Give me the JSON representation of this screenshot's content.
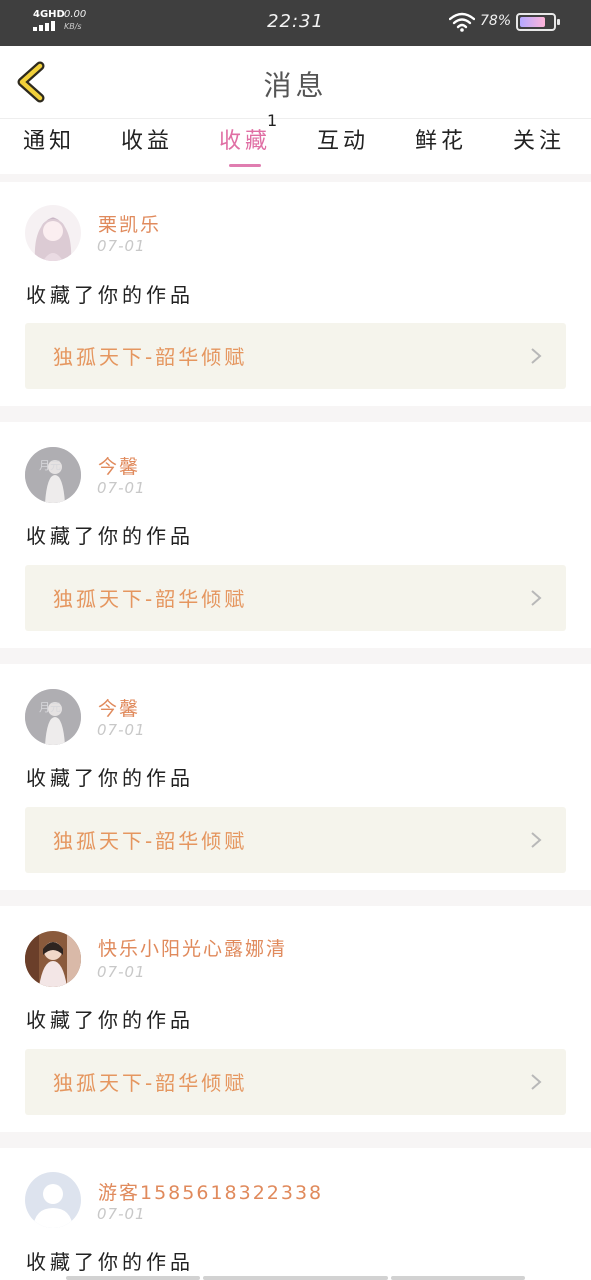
{
  "status_bar": {
    "network": "4GHD",
    "speed": "0.00",
    "speed_unit": "KB/s",
    "time": "22:31",
    "battery": "78%"
  },
  "header": {
    "title": "消息"
  },
  "tabs": [
    {
      "label": "通知"
    },
    {
      "label": "收益"
    },
    {
      "label": "收藏",
      "badge": "1",
      "active": true
    },
    {
      "label": "互动"
    },
    {
      "label": "鲜花"
    },
    {
      "label": "关注"
    }
  ],
  "items": [
    {
      "user": "栗凯乐",
      "date": "07-01",
      "action": "收藏了你的作品",
      "work": "独孤天下-韶华倾赋",
      "avatar": "anime-girl"
    },
    {
      "user": "今馨",
      "date": "07-01",
      "action": "收藏了你的作品",
      "work": "独孤天下-韶华倾赋",
      "avatar": "grey-photo"
    },
    {
      "user": "今馨",
      "date": "07-01",
      "action": "收藏了你的作品",
      "work": "独孤天下-韶华倾赋",
      "avatar": "grey-photo"
    },
    {
      "user": "快乐小阳光心露娜清",
      "date": "07-01",
      "action": "收藏了你的作品",
      "work": "独孤天下-韶华倾赋",
      "avatar": "photo-girl"
    },
    {
      "user": "游客1585618322338",
      "date": "07-01",
      "action": "收藏了你的作品",
      "work": "独孤天下-韶华倾赋",
      "avatar": "default-person"
    }
  ],
  "colors": {
    "accent_pink": "#e06fa4",
    "name_orange": "#e08a5c",
    "link_bg": "#f5f4ec",
    "badge_red": "#f24b5f"
  }
}
